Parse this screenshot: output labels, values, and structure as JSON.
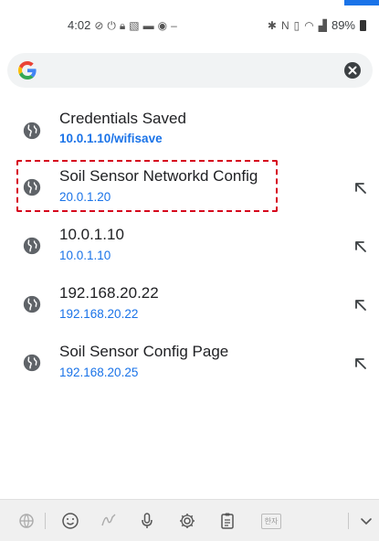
{
  "status_bar": {
    "time": "4:02",
    "battery": "89%",
    "left_icons": [
      "do-not-disturb-icon",
      "power-icon",
      "lock-icon",
      "gallery-icon",
      "card-icon",
      "eye-icon",
      "dash-icon"
    ],
    "right_icons": [
      "bluetooth-icon",
      "nfc-icon",
      "vibrate-icon",
      "wifi-icon",
      "signal-icon"
    ]
  },
  "search": {
    "logo": "google-g-logo",
    "value": "",
    "clear_icon": "clear-icon"
  },
  "suggestions": [
    {
      "title": "Credentials Saved",
      "url": "10.0.1.10/wifisave",
      "url_bold": true,
      "fill_arrow": false
    },
    {
      "title": "Soil Sensor Networkd Config",
      "url": "20.0.1.20",
      "url_bold": false,
      "fill_arrow": true
    },
    {
      "title": "10.0.1.10",
      "url": "10.0.1.10",
      "url_bold": false,
      "fill_arrow": true
    },
    {
      "title": "192.168.20.22",
      "url": "192.168.20.22",
      "url_bold": false,
      "fill_arrow": true
    },
    {
      "title": "Soil Sensor Config Page",
      "url": "192.168.20.25",
      "url_bold": false,
      "fill_arrow": true
    }
  ],
  "keyboard_toolbar": {
    "items": [
      "translate-icon",
      "emoji-icon",
      "handwriting-icon",
      "microphone-icon",
      "settings-icon",
      "clipboard-icon",
      "hanja-icon",
      "collapse-icon"
    ],
    "hanja_label": "한자"
  },
  "colors": {
    "link_blue": "#1a73e8",
    "highlight_red": "#d6001c",
    "search_bg": "#f1f3f4",
    "keyboard_bg": "#f0f0f0"
  }
}
